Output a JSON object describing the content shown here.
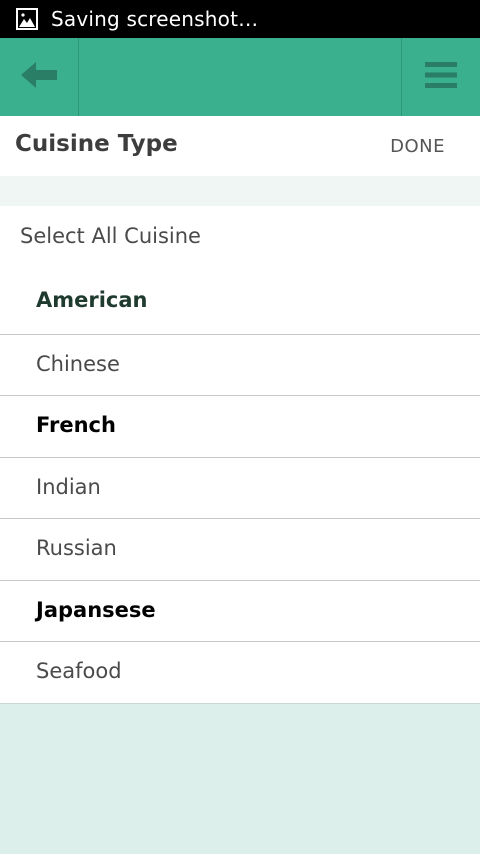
{
  "status_bar": {
    "icon": "image-icon",
    "text": "Saving screenshot…"
  },
  "app_bar": {
    "back_icon": "arrow-left-icon",
    "menu_icon": "hamburger-menu-icon",
    "color": "#3bb08e"
  },
  "header": {
    "title": "Cuisine Type",
    "done_label": "DONE"
  },
  "list": {
    "select_all_label": "Select All Cuisine",
    "items": [
      {
        "label": "American",
        "selected": true
      },
      {
        "label": "Chinese",
        "selected": false
      },
      {
        "label": "French",
        "selected": true
      },
      {
        "label": "Indian",
        "selected": false
      },
      {
        "label": "Russian",
        "selected": false
      },
      {
        "label": "Japansese",
        "selected": true
      },
      {
        "label": "Seafood",
        "selected": false
      }
    ]
  },
  "colors": {
    "accent": "#3bb08e",
    "page_background": "#dcefea"
  }
}
